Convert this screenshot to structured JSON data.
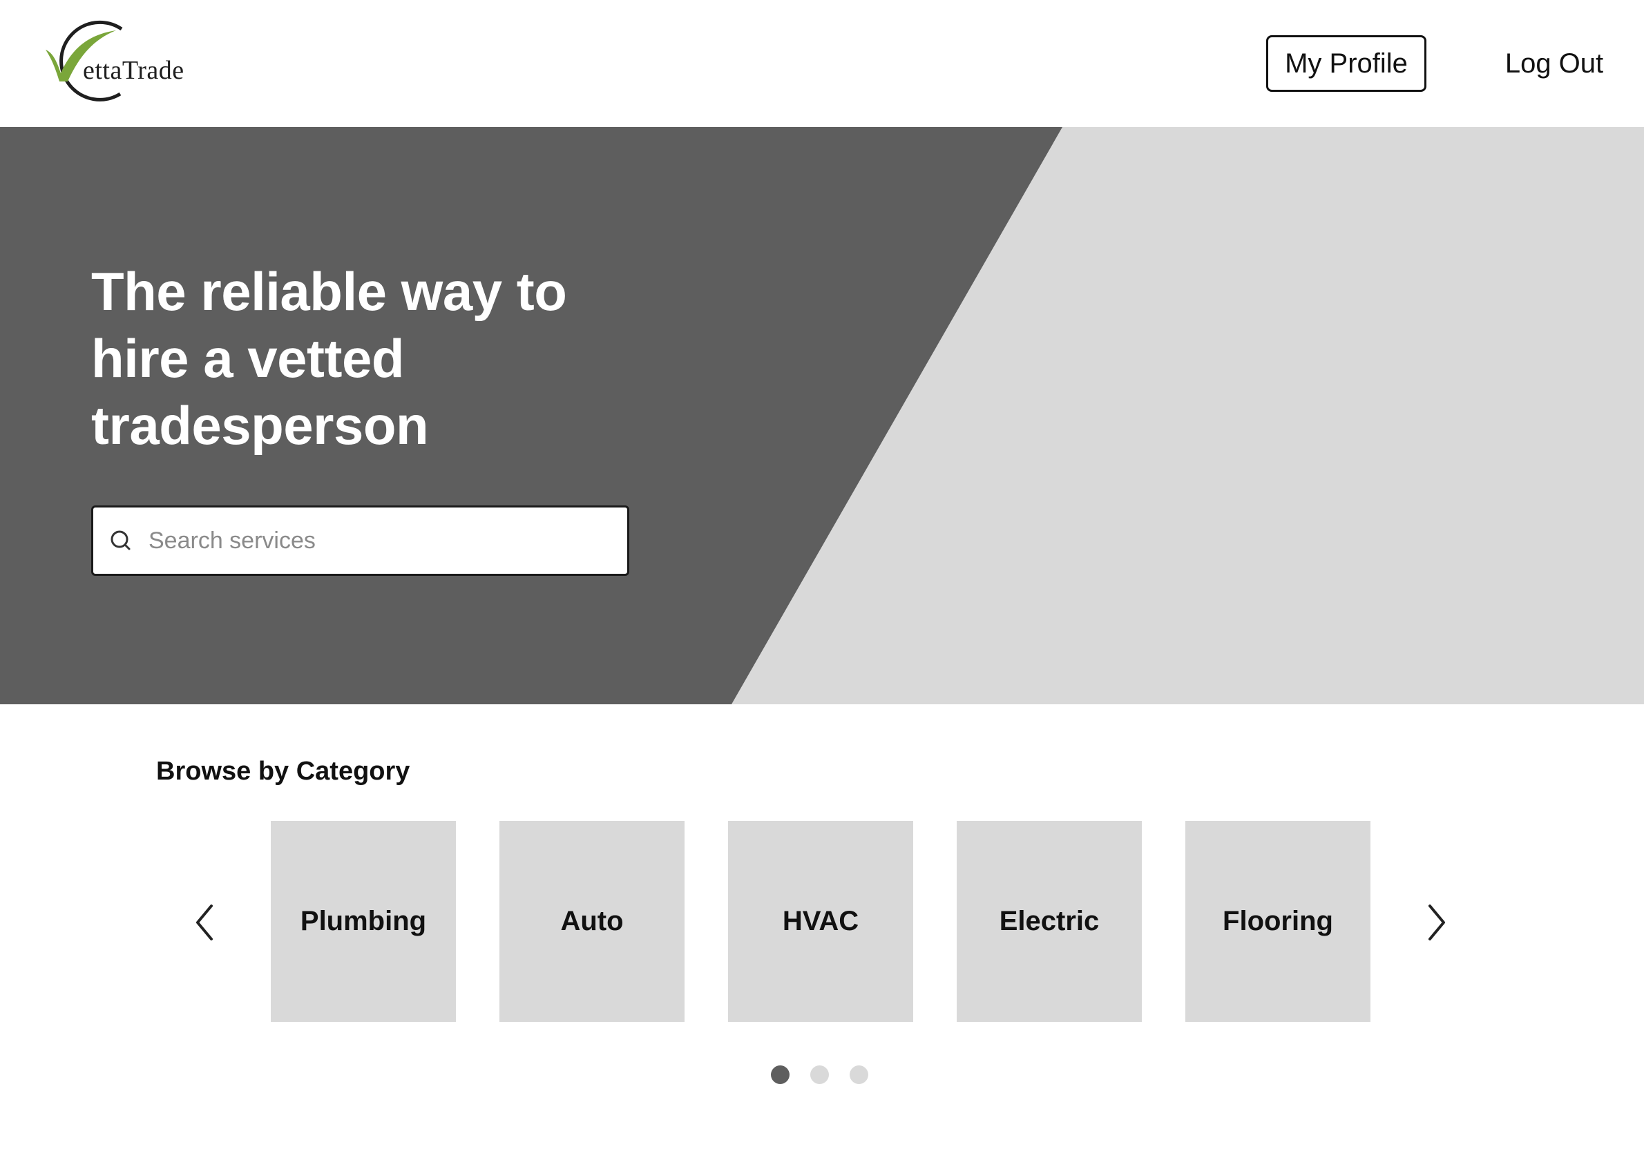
{
  "brand": {
    "logo_text": "ettaTrade",
    "logo_icon": "check-circle-icon",
    "accent_color": "#7aa63a"
  },
  "header": {
    "profile_label": "My Profile",
    "logout_label": "Log Out"
  },
  "hero": {
    "title": "The reliable way to hire a vetted tradesperson",
    "search_placeholder": "Search services",
    "search_value": ""
  },
  "categories": {
    "title": "Browse by Category",
    "items": [
      {
        "label": "Plumbing"
      },
      {
        "label": "Auto"
      },
      {
        "label": "HVAC"
      },
      {
        "label": "Electric"
      },
      {
        "label": "Flooring"
      }
    ],
    "prev_icon": "chevron-left-icon",
    "next_icon": "chevron-right-icon",
    "pages": 3,
    "active_page": 1
  },
  "colors": {
    "hero_dark": "#5e5e5e",
    "hero_light": "#d9d9d9",
    "card_bg": "#d9d9d9"
  }
}
